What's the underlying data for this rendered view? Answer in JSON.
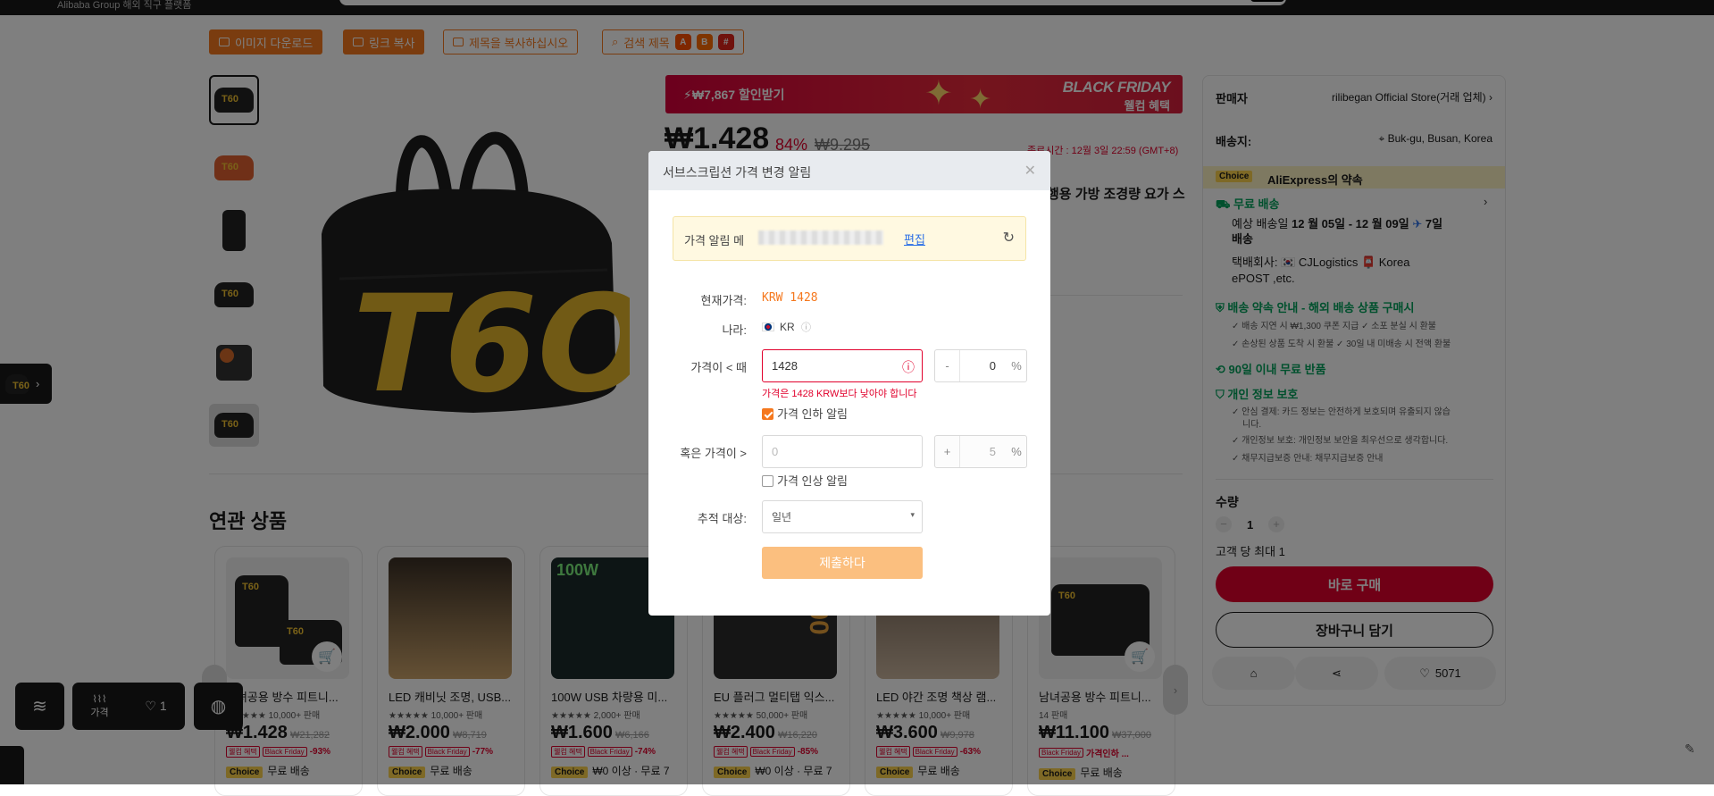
{
  "top": {
    "brand": "Alibaba Group 해외 직구 플랫폼"
  },
  "toolbar": {
    "download_images": "이미지 다운로드",
    "copy_link": "링크 복사",
    "copy_title": "제목을 복사하십시오",
    "search_title": "검색 제목",
    "icon_a": "A",
    "icon_b": "B",
    "icon_c": "#"
  },
  "promo": {
    "label": "⚡₩7,867 할인받기",
    "bf_title": "BLACK FRIDAY",
    "bf_sub": "웰컴 혜택"
  },
  "product": {
    "price": "₩1.428",
    "discount": "84%",
    "original_price": "₩9.295",
    "end_time": "종료시간 : 12월 3일 22:59 (GMT+8)",
    "title_fragment": "행용 가방 조경량 요가 스"
  },
  "related": {
    "heading": "연관 상품",
    "cards": [
      {
        "name": "남녀공용 방수 피트니...",
        "rating": "★★★★★ 10,000+ 판매",
        "price": "₩1.428",
        "orig": "₩21,282",
        "pct": "-93%",
        "choice": "무료 배송"
      },
      {
        "name": "LED 캐비닛 조명, USB...",
        "rating": "★★★★★ 10,000+ 판매",
        "price": "₩2.000",
        "orig": "₩8,719",
        "pct": "-77%",
        "choice": "무료 배송"
      },
      {
        "name": "100W USB 차량용 미...",
        "rating": "★★★★★ 2,000+ 판매",
        "price": "₩1.600",
        "orig": "₩6,166",
        "pct": "-74%",
        "choice": "₩0 이상 · 무료 7"
      },
      {
        "name": "EU 플러그 멀티탭 익스...",
        "rating": "★★★★★ 50,000+ 판매",
        "price": "₩2.400",
        "orig": "₩16,220",
        "pct": "-85%",
        "choice": "₩0 이상 · 무료 7"
      },
      {
        "name": "LED 야간 조명 책상 램...",
        "rating": "★★★★★ 10,000+ 판매",
        "price": "₩3.600",
        "orig": "₩9,978",
        "pct": "-63%",
        "choice": "무료 배송"
      },
      {
        "name": "남녀공용 방수 피트니...",
        "rating": "14 판매",
        "price": "₩11.100",
        "orig": "₩37,000",
        "pct": "가격인하 ...",
        "choice": "무료 배송"
      }
    ],
    "tag_welcome": "웰컴 혜택",
    "tag_bf": "Black Friday",
    "choice_badge": "Choice"
  },
  "side": {
    "seller_label": "판매자",
    "seller_name": "rilibegan Official Store(거래 업체)",
    "ship_label": "배송지:",
    "ship_location": "Buk-gu, Busan, Korea",
    "choice_badge": "Choice",
    "choice_promise": "AliExpress의 약속",
    "free_ship": "무료 배송",
    "est_prefix": "예상 배송일 ",
    "est_dates": "12 월 05일 - 12 월 09일",
    "est_days": "7일",
    "est_suffix": "배송",
    "courier_line1": "택배회사: 🇰🇷 CJLogistics 📮 Korea",
    "courier_line2": "ePOST ,etc.",
    "promise_title": "배송 약속 안내 - 해외 배송 상품 구매시",
    "promise_a": "✓ 배송 지연 시 ₩1,300 쿠폰 지급  ✓ 소포 분실 시 환불",
    "promise_b": "✓ 손상된 상품 도착 시 환불  ✓ 30일 내 미배송 시 전액 환불",
    "return": "90일 이내 무료 반품",
    "privacy": "개인 정보 보호",
    "priv_a": "✓ 안심 결제: 카드 정보는 안전하게 보호되며 유출되지 않습",
    "priv_a2": "니다.",
    "priv_b": "✓ 개인정보 보호: 개인정보 보안을 최우선으로 생각합니다.",
    "priv_c": "✓ 채무지급보증 안내: 채무지급보증 안내",
    "qty_label": "수량",
    "qty": "1",
    "max_per": "고객 당 최대 1",
    "buy_now": "바로 구매",
    "add_cart": "장바구니 담기",
    "like_count": "5071"
  },
  "bottom": {
    "price_label": "가격",
    "like": "1"
  },
  "modal": {
    "title": "서브스크립션 가격 변경 알림",
    "note_prefix": "가격 알림 메",
    "edit": "편집",
    "current_label": "현재가격:",
    "current_value": "KRW 1428",
    "country_label": "나라:",
    "country_value": "KR",
    "below_label": "가격이 < 때",
    "below_value": "1428",
    "pct_minus": "-",
    "pct_minus_value": "0",
    "pct_sign": "%",
    "error": "가격은 1428 KRW보다 낮아야 합니다",
    "drop_alert": "가격 인하 알림",
    "above_label": "혹은 가격이 >",
    "above_placeholder": "0",
    "pct_plus": "+",
    "pct_plus_value": "5",
    "rise_alert": "가격 인상 알림",
    "track_label": "추적 대상:",
    "track_value": "일년",
    "submit": "제출하다"
  }
}
